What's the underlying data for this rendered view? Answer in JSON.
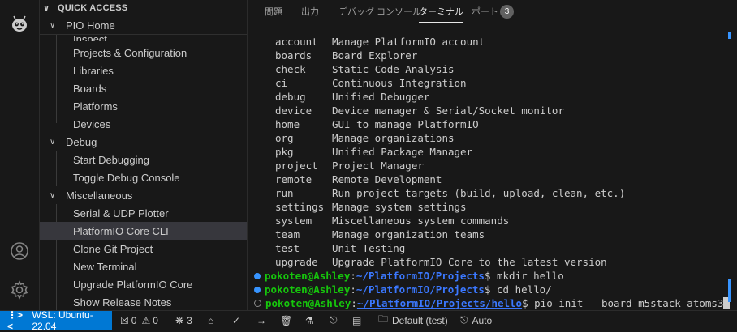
{
  "sidebar": {
    "header": "QUICK ACCESS",
    "groups": [
      {
        "label": "PIO Home",
        "items": [
          "Inspect",
          "Projects & Configuration",
          "Libraries",
          "Boards",
          "Platforms",
          "Devices"
        ]
      },
      {
        "label": "Debug",
        "items": [
          "Start Debugging",
          "Toggle Debug Console"
        ]
      },
      {
        "label": "Miscellaneous",
        "items": [
          "Serial & UDP Plotter",
          "PlatformIO Core CLI",
          "Clone Git Project",
          "New Terminal",
          "Upgrade PlatformIO Core",
          "Show Release Notes"
        ]
      }
    ],
    "selected_item": "PlatformIO Core CLI"
  },
  "activity_bar": {
    "icons": [
      "platformio-alien-icon",
      "account-icon",
      "settings-gear-icon"
    ]
  },
  "panel": {
    "tabs": [
      "問題",
      "出力",
      "デバッグ コンソール",
      "ターミナル",
      "ポート"
    ],
    "active_tab": "ターミナル",
    "ports_badge": "3"
  },
  "terminal": {
    "commands": [
      {
        "name": "account",
        "desc": "Manage PlatformIO account"
      },
      {
        "name": "boards",
        "desc": "Board Explorer"
      },
      {
        "name": "check",
        "desc": "Static Code Analysis"
      },
      {
        "name": "ci",
        "desc": "Continuous Integration"
      },
      {
        "name": "debug",
        "desc": "Unified Debugger"
      },
      {
        "name": "device",
        "desc": "Device manager & Serial/Socket monitor"
      },
      {
        "name": "home",
        "desc": "GUI to manage PlatformIO"
      },
      {
        "name": "org",
        "desc": "Manage organizations"
      },
      {
        "name": "pkg",
        "desc": "Unified Package Manager"
      },
      {
        "name": "project",
        "desc": "Project Manager"
      },
      {
        "name": "remote",
        "desc": "Remote Development"
      },
      {
        "name": "run",
        "desc": "Run project targets (build, upload, clean, etc.)"
      },
      {
        "name": "settings",
        "desc": "Manage system settings"
      },
      {
        "name": "system",
        "desc": "Miscellaneous system commands"
      },
      {
        "name": "team",
        "desc": "Manage organization teams"
      },
      {
        "name": "test",
        "desc": "Unit Testing"
      },
      {
        "name": "upgrade",
        "desc": "Upgrade PlatformIO Core to the latest version"
      }
    ],
    "prompts": [
      {
        "user": "pokoten@Ashley",
        "path": "~/PlatformIO/Projects",
        "cmd": "mkdir hello"
      },
      {
        "user": "pokoten@Ashley",
        "path": "~/PlatformIO/Projects",
        "cmd": "cd hello/"
      },
      {
        "user": "pokoten@Ashley",
        "path": "~/PlatformIO/Projects/hello",
        "cmd": "pio init --board m5stack-atoms3"
      }
    ]
  },
  "statusbar": {
    "remote": "WSL: Ubuntu-22.04",
    "errors": "0",
    "warnings": "0",
    "ports": "3",
    "env": "Default (test)",
    "auto": "Auto"
  },
  "colors": {
    "accent": "#0078d4",
    "prompt_user": "#16c60c",
    "prompt_path": "#3b78ff"
  }
}
